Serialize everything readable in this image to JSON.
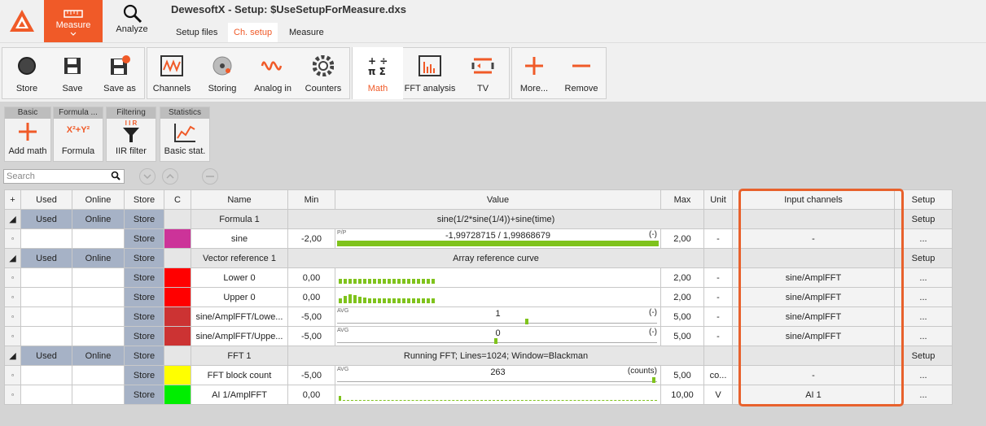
{
  "app": {
    "title": "DewesoftX - Setup: $UseSetupForMeasure.dxs"
  },
  "main_tabs": [
    {
      "label": "Measure",
      "active": true
    },
    {
      "label": "Analyze",
      "active": false
    }
  ],
  "sub_tabs": [
    {
      "label": "Setup files"
    },
    {
      "label": "Ch. setup",
      "active": true
    },
    {
      "label": "Measure"
    }
  ],
  "toolbar": {
    "file": [
      {
        "label": "Store",
        "icon": "record-icon"
      },
      {
        "label": "Save",
        "icon": "floppy-icon"
      },
      {
        "label": "Save as",
        "icon": "floppy-edit-icon"
      }
    ],
    "channels": [
      {
        "label": "Channels",
        "icon": "channels-icon"
      },
      {
        "label": "Storing",
        "icon": "storing-icon"
      },
      {
        "label": "Analog in",
        "icon": "analog-wave-icon"
      },
      {
        "label": "Counters",
        "icon": "counter-gear-icon"
      }
    ],
    "math": [
      {
        "label": "Math",
        "icon": "math-icon",
        "selected": true
      },
      {
        "label": "FFT analysis",
        "icon": "fft-icon"
      },
      {
        "label": "TV",
        "icon": "tv-icon"
      }
    ],
    "more": [
      {
        "label": "More...",
        "icon": "plus-icon"
      },
      {
        "label": "Remove",
        "icon": "minus-icon"
      }
    ]
  },
  "math_groups": [
    {
      "header": "Basic",
      "button": "Add math",
      "icon": "plus-icon"
    },
    {
      "header": "Formula ...",
      "button": "Formula",
      "icon": "formula-icon",
      "icon_text": "X²+Y²"
    },
    {
      "header": "Filtering",
      "button": "IIR filter",
      "icon": "filter-icon",
      "icon_text": "I I R"
    },
    {
      "header": "Statistics",
      "button": "Basic stat.",
      "icon": "stats-icon"
    }
  ],
  "search": {
    "placeholder": "Search"
  },
  "columns": {
    "plus": "+",
    "used": "Used",
    "online": "Online",
    "store": "Store",
    "c": "C",
    "name": "Name",
    "min": "Min",
    "value": "Value",
    "max": "Max",
    "unit": "Unit",
    "input": "Input channels",
    "setup": "Setup"
  },
  "groups": [
    {
      "used": "Used",
      "online": "Online",
      "store": "Store",
      "name": "Formula 1",
      "value": "sine(1/2*sine(1/4))+sine(time)",
      "setup": "Setup"
    },
    {
      "used": "Used",
      "online": "Online",
      "store": "Store",
      "name": "Vector reference 1",
      "value": "Array reference curve",
      "setup": "Setup"
    },
    {
      "used": "Used",
      "online": "Online",
      "store": "Store",
      "name": "FFT 1",
      "value": "Running FFT; Lines=1024; Window=Blackman",
      "setup": "Setup"
    }
  ],
  "rows": [
    {
      "store": "Store",
      "color": "#cc3399",
      "name": "sine",
      "min": "-2,00",
      "vlabel": "P/P",
      "value": "-1,99728715 / 1,99868679",
      "vunit": "(-)",
      "max": "2,00",
      "unit": "-",
      "input": "-",
      "setup": "...",
      "fill": 1.0
    },
    {
      "store": "Store",
      "color": "#ff0000",
      "name": "Lower 0",
      "min": "0,00",
      "max": "2,00",
      "unit": "-",
      "input": "sine/AmplFFT",
      "setup": "..."
    },
    {
      "store": "Store",
      "color": "#ff0000",
      "name": "Upper 0",
      "min": "0,00",
      "max": "2,00",
      "unit": "-",
      "input": "sine/AmplFFT",
      "setup": "..."
    },
    {
      "store": "Store",
      "color": "#cc3333",
      "name": "sine/AmplFFT/Lowe...",
      "min": "-5,00",
      "vlabel": "AVG",
      "value": "1",
      "vunit": "(-)",
      "max": "5,00",
      "unit": "-",
      "input": "sine/AmplFFT",
      "setup": "...",
      "level": 0.6
    },
    {
      "store": "Store",
      "color": "#cc3333",
      "name": "sine/AmplFFT/Uppe...",
      "min": "-5,00",
      "vlabel": "AVG",
      "value": "0",
      "vunit": "(-)",
      "max": "5,00",
      "unit": "-",
      "input": "sine/AmplFFT",
      "setup": "...",
      "level": 0.5
    },
    {
      "store": "Store",
      "color": "#ffff00",
      "name": "FFT block count",
      "min": "-5,00",
      "vlabel": "AVG",
      "value": "263",
      "vunit": "(counts)",
      "max": "5,00",
      "unit": "co...",
      "input": "-",
      "setup": "...",
      "level": 1.0
    },
    {
      "store": "Store",
      "color": "#00ee00",
      "name": "AI 1/AmplFFT",
      "min": "0,00",
      "max": "10,00",
      "unit": "V",
      "input": "AI 1",
      "setup": "..."
    }
  ],
  "colors": {
    "accent": "#f05a28",
    "bar": "#7fc31c",
    "store_bg": "#a6b2c6"
  }
}
